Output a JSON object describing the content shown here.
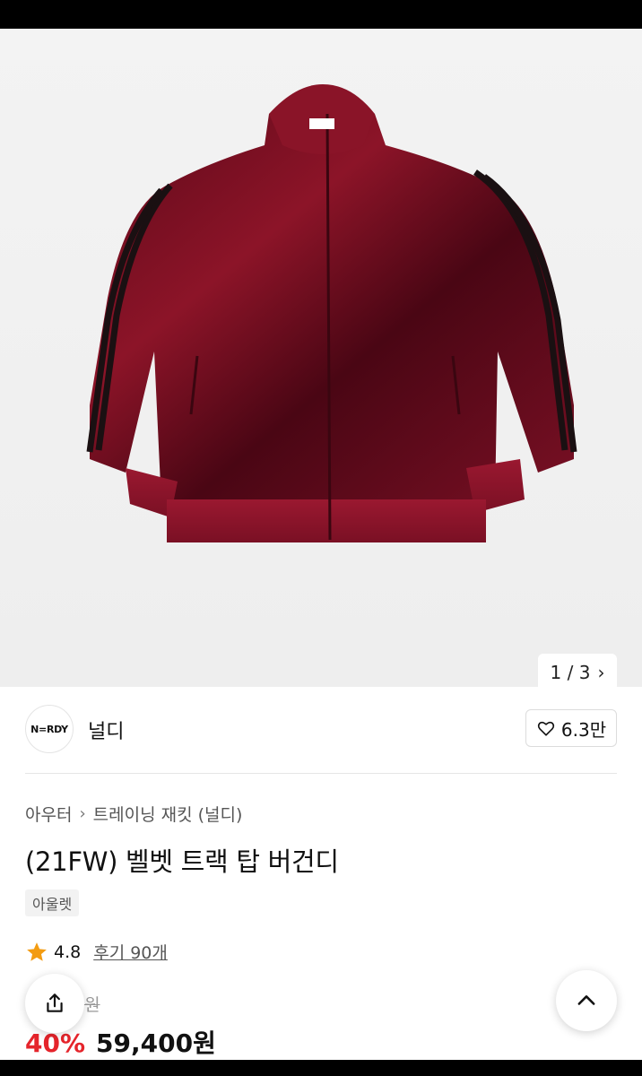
{
  "gallery": {
    "counter_text": "1 / 3",
    "next_icon": "chevron-right-icon"
  },
  "brand": {
    "logo_text": "N=RDY",
    "name": "널디",
    "likes": "6.3만"
  },
  "breadcrumb": {
    "category": "아우터",
    "subcategory": "트레이닝 재킷 (널디)"
  },
  "product": {
    "title": "(21FW) 벨벳 트랙 탑 버건디",
    "tag": "아울렛",
    "rating": "4.8",
    "reviews": "후기 90개",
    "original_price_visible": "9원",
    "discount": "40%",
    "price": "59,400원"
  },
  "colors": {
    "accent_red": "#e5242b",
    "jacket_burgundy": "#6b0c1e",
    "star_orange": "#f39c12"
  }
}
